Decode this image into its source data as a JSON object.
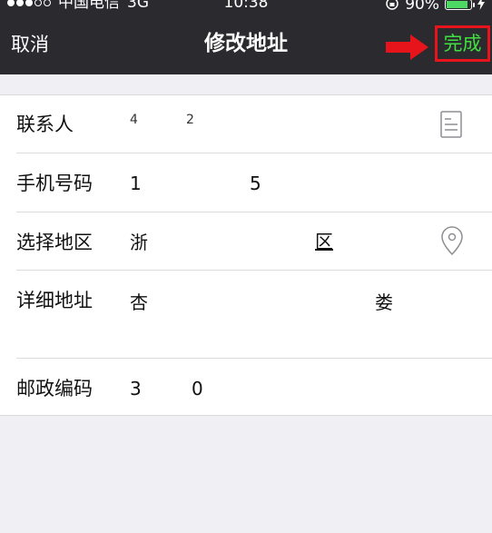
{
  "status_bar": {
    "carrier": "中国电信",
    "network": "3G",
    "time": "10:38",
    "battery": "90%",
    "battery_level": 0.9
  },
  "nav": {
    "cancel_label": "取消",
    "title": "修改地址",
    "done_label": "完成"
  },
  "form": {
    "contact": {
      "label": "联系人",
      "value_part1": "4",
      "value_part2": "2"
    },
    "phone": {
      "label": "手机号码",
      "value_part1": "1",
      "value_part2": "5"
    },
    "region": {
      "label": "选择地区",
      "value_part1": "浙",
      "value_part2": "区"
    },
    "address": {
      "label": "详细地址",
      "value_part1": "杏",
      "value_part2": "娄"
    },
    "postcode": {
      "label": "邮政编码",
      "value_part1": "3",
      "value_part2": "0"
    }
  },
  "colors": {
    "nav_background": "#2b2b2f",
    "done_text": "#3fe03f",
    "highlight_red": "#e8141b",
    "page_background": "#efeff4"
  },
  "icons": [
    "contact-book-icon",
    "location-pin-icon",
    "annotation-arrow-icon"
  ]
}
